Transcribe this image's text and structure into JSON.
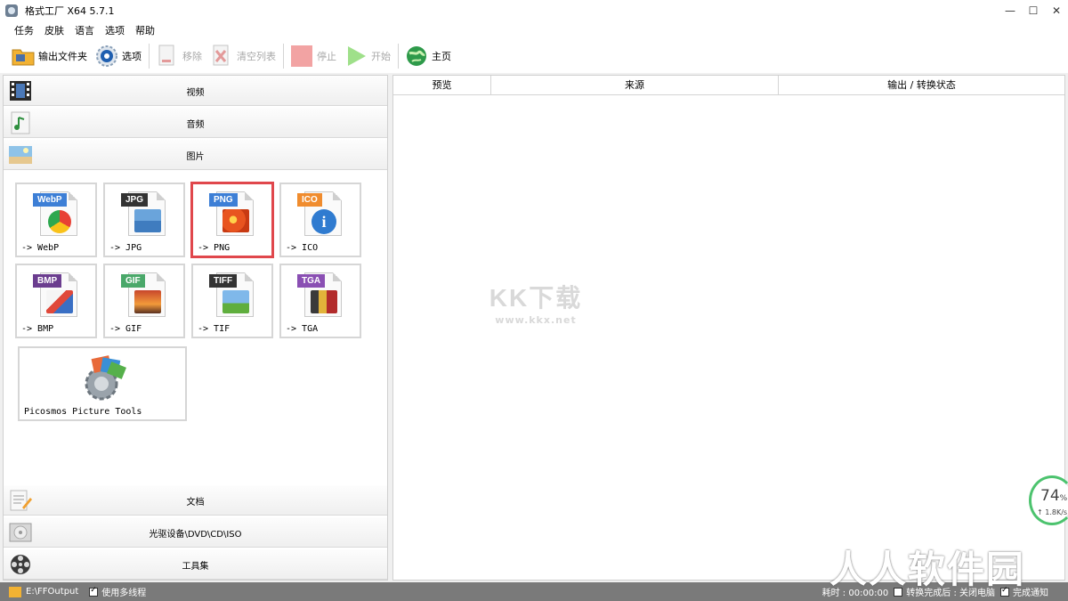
{
  "window": {
    "title": "格式工厂 X64 5.7.1",
    "controls": [
      "—",
      "☐",
      "✕"
    ]
  },
  "menu": [
    "任务",
    "皮肤",
    "语言",
    "选项",
    "帮助"
  ],
  "toolbar": {
    "output_folder": "输出文件夹",
    "options": "选项",
    "remove": "移除",
    "clear_list": "清空列表",
    "stop": "停止",
    "start": "开始",
    "home": "主页"
  },
  "categories": {
    "video": "视频",
    "audio": "音频",
    "image": "图片",
    "document": "文档",
    "disc": "光驱设备\\DVD\\CD\\ISO",
    "tools": "工具集"
  },
  "image_formats": [
    {
      "badge": "WebP",
      "label": "-> WebP",
      "badge_color": "#3d7fd6"
    },
    {
      "badge": "JPG",
      "label": "-> JPG",
      "badge_color": "#333333"
    },
    {
      "badge": "PNG",
      "label": "-> PNG",
      "badge_color": "#3d7fd6"
    },
    {
      "badge": "ICO",
      "label": "-> ICO",
      "badge_color": "#f08c2e"
    },
    {
      "badge": "BMP",
      "label": "-> BMP",
      "badge_color": "#6b3d8f"
    },
    {
      "badge": "GIF",
      "label": "-> GIF",
      "badge_color": "#4aa86a"
    },
    {
      "badge": "TIFF",
      "label": "-> TIF",
      "badge_color": "#333333"
    },
    {
      "badge": "TGA",
      "label": "-> TGA",
      "badge_color": "#8a4fb3"
    }
  ],
  "tools_tile": {
    "label": "Picosmos Picture Tools"
  },
  "table": {
    "columns": [
      "预览",
      "来源",
      "输出 / 转换状态"
    ]
  },
  "watermark": {
    "big": "KK下载",
    "small": "www.kkx.net"
  },
  "status": {
    "output_path": "E:\\FFOutput",
    "multithread": "使用多线程",
    "elapsed": "耗时 : 00:00:00",
    "after_convert": "转换完成后 : 关闭电脑",
    "notify": "完成通知"
  },
  "speed_widget": {
    "percent": "74",
    "unit": "%",
    "rate": "↑ 1.8K/s"
  },
  "brand_overlay": "人人软件园",
  "colors": {
    "selected_border": "#e0474c",
    "status_bar": "#7a7a7a"
  }
}
